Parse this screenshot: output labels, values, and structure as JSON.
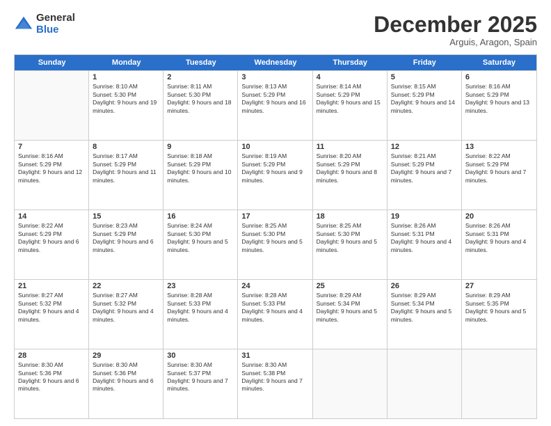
{
  "header": {
    "logo_general": "General",
    "logo_blue": "Blue",
    "month_title": "December 2025",
    "location": "Arguis, Aragon, Spain"
  },
  "days_of_week": [
    "Sunday",
    "Monday",
    "Tuesday",
    "Wednesday",
    "Thursday",
    "Friday",
    "Saturday"
  ],
  "weeks": [
    [
      {
        "day": "",
        "sunrise": "",
        "sunset": "",
        "daylight": "",
        "empty": true
      },
      {
        "day": "1",
        "sunrise": "Sunrise: 8:10 AM",
        "sunset": "Sunset: 5:30 PM",
        "daylight": "Daylight: 9 hours and 19 minutes.",
        "empty": false
      },
      {
        "day": "2",
        "sunrise": "Sunrise: 8:11 AM",
        "sunset": "Sunset: 5:30 PM",
        "daylight": "Daylight: 9 hours and 18 minutes.",
        "empty": false
      },
      {
        "day": "3",
        "sunrise": "Sunrise: 8:13 AM",
        "sunset": "Sunset: 5:29 PM",
        "daylight": "Daylight: 9 hours and 16 minutes.",
        "empty": false
      },
      {
        "day": "4",
        "sunrise": "Sunrise: 8:14 AM",
        "sunset": "Sunset: 5:29 PM",
        "daylight": "Daylight: 9 hours and 15 minutes.",
        "empty": false
      },
      {
        "day": "5",
        "sunrise": "Sunrise: 8:15 AM",
        "sunset": "Sunset: 5:29 PM",
        "daylight": "Daylight: 9 hours and 14 minutes.",
        "empty": false
      },
      {
        "day": "6",
        "sunrise": "Sunrise: 8:16 AM",
        "sunset": "Sunset: 5:29 PM",
        "daylight": "Daylight: 9 hours and 13 minutes.",
        "empty": false
      }
    ],
    [
      {
        "day": "7",
        "sunrise": "Sunrise: 8:16 AM",
        "sunset": "Sunset: 5:29 PM",
        "daylight": "Daylight: 9 hours and 12 minutes.",
        "empty": false
      },
      {
        "day": "8",
        "sunrise": "Sunrise: 8:17 AM",
        "sunset": "Sunset: 5:29 PM",
        "daylight": "Daylight: 9 hours and 11 minutes.",
        "empty": false
      },
      {
        "day": "9",
        "sunrise": "Sunrise: 8:18 AM",
        "sunset": "Sunset: 5:29 PM",
        "daylight": "Daylight: 9 hours and 10 minutes.",
        "empty": false
      },
      {
        "day": "10",
        "sunrise": "Sunrise: 8:19 AM",
        "sunset": "Sunset: 5:29 PM",
        "daylight": "Daylight: 9 hours and 9 minutes.",
        "empty": false
      },
      {
        "day": "11",
        "sunrise": "Sunrise: 8:20 AM",
        "sunset": "Sunset: 5:29 PM",
        "daylight": "Daylight: 9 hours and 8 minutes.",
        "empty": false
      },
      {
        "day": "12",
        "sunrise": "Sunrise: 8:21 AM",
        "sunset": "Sunset: 5:29 PM",
        "daylight": "Daylight: 9 hours and 7 minutes.",
        "empty": false
      },
      {
        "day": "13",
        "sunrise": "Sunrise: 8:22 AM",
        "sunset": "Sunset: 5:29 PM",
        "daylight": "Daylight: 9 hours and 7 minutes.",
        "empty": false
      }
    ],
    [
      {
        "day": "14",
        "sunrise": "Sunrise: 8:22 AM",
        "sunset": "Sunset: 5:29 PM",
        "daylight": "Daylight: 9 hours and 6 minutes.",
        "empty": false
      },
      {
        "day": "15",
        "sunrise": "Sunrise: 8:23 AM",
        "sunset": "Sunset: 5:29 PM",
        "daylight": "Daylight: 9 hours and 6 minutes.",
        "empty": false
      },
      {
        "day": "16",
        "sunrise": "Sunrise: 8:24 AM",
        "sunset": "Sunset: 5:30 PM",
        "daylight": "Daylight: 9 hours and 5 minutes.",
        "empty": false
      },
      {
        "day": "17",
        "sunrise": "Sunrise: 8:25 AM",
        "sunset": "Sunset: 5:30 PM",
        "daylight": "Daylight: 9 hours and 5 minutes.",
        "empty": false
      },
      {
        "day": "18",
        "sunrise": "Sunrise: 8:25 AM",
        "sunset": "Sunset: 5:30 PM",
        "daylight": "Daylight: 9 hours and 5 minutes.",
        "empty": false
      },
      {
        "day": "19",
        "sunrise": "Sunrise: 8:26 AM",
        "sunset": "Sunset: 5:31 PM",
        "daylight": "Daylight: 9 hours and 4 minutes.",
        "empty": false
      },
      {
        "day": "20",
        "sunrise": "Sunrise: 8:26 AM",
        "sunset": "Sunset: 5:31 PM",
        "daylight": "Daylight: 9 hours and 4 minutes.",
        "empty": false
      }
    ],
    [
      {
        "day": "21",
        "sunrise": "Sunrise: 8:27 AM",
        "sunset": "Sunset: 5:32 PM",
        "daylight": "Daylight: 9 hours and 4 minutes.",
        "empty": false
      },
      {
        "day": "22",
        "sunrise": "Sunrise: 8:27 AM",
        "sunset": "Sunset: 5:32 PM",
        "daylight": "Daylight: 9 hours and 4 minutes.",
        "empty": false
      },
      {
        "day": "23",
        "sunrise": "Sunrise: 8:28 AM",
        "sunset": "Sunset: 5:33 PM",
        "daylight": "Daylight: 9 hours and 4 minutes.",
        "empty": false
      },
      {
        "day": "24",
        "sunrise": "Sunrise: 8:28 AM",
        "sunset": "Sunset: 5:33 PM",
        "daylight": "Daylight: 9 hours and 4 minutes.",
        "empty": false
      },
      {
        "day": "25",
        "sunrise": "Sunrise: 8:29 AM",
        "sunset": "Sunset: 5:34 PM",
        "daylight": "Daylight: 9 hours and 5 minutes.",
        "empty": false
      },
      {
        "day": "26",
        "sunrise": "Sunrise: 8:29 AM",
        "sunset": "Sunset: 5:34 PM",
        "daylight": "Daylight: 9 hours and 5 minutes.",
        "empty": false
      },
      {
        "day": "27",
        "sunrise": "Sunrise: 8:29 AM",
        "sunset": "Sunset: 5:35 PM",
        "daylight": "Daylight: 9 hours and 5 minutes.",
        "empty": false
      }
    ],
    [
      {
        "day": "28",
        "sunrise": "Sunrise: 8:30 AM",
        "sunset": "Sunset: 5:36 PM",
        "daylight": "Daylight: 9 hours and 6 minutes.",
        "empty": false
      },
      {
        "day": "29",
        "sunrise": "Sunrise: 8:30 AM",
        "sunset": "Sunset: 5:36 PM",
        "daylight": "Daylight: 9 hours and 6 minutes.",
        "empty": false
      },
      {
        "day": "30",
        "sunrise": "Sunrise: 8:30 AM",
        "sunset": "Sunset: 5:37 PM",
        "daylight": "Daylight: 9 hours and 7 minutes.",
        "empty": false
      },
      {
        "day": "31",
        "sunrise": "Sunrise: 8:30 AM",
        "sunset": "Sunset: 5:38 PM",
        "daylight": "Daylight: 9 hours and 7 minutes.",
        "empty": false
      },
      {
        "day": "",
        "sunrise": "",
        "sunset": "",
        "daylight": "",
        "empty": true
      },
      {
        "day": "",
        "sunrise": "",
        "sunset": "",
        "daylight": "",
        "empty": true
      },
      {
        "day": "",
        "sunrise": "",
        "sunset": "",
        "daylight": "",
        "empty": true
      }
    ]
  ]
}
